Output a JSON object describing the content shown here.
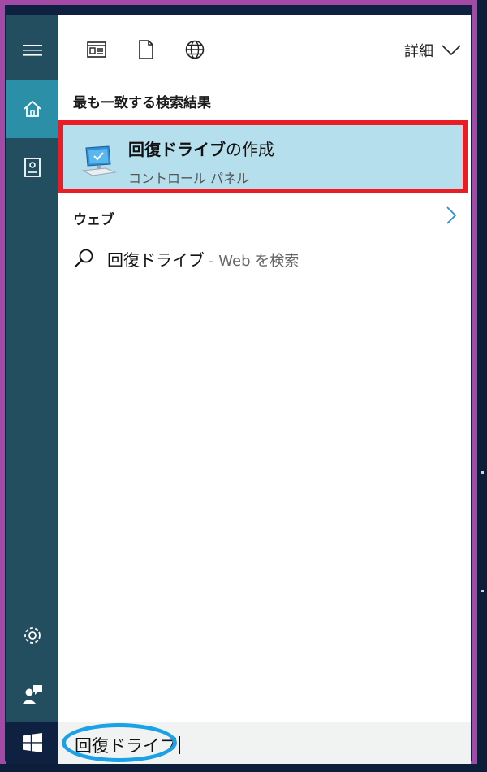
{
  "toolbar": {
    "icons": [
      "news-app-icon",
      "document-icon",
      "globe-icon"
    ],
    "details_label": "詳細"
  },
  "sidebar": {
    "items": [
      "hamburger-menu-icon",
      "home-icon",
      "notebook-icon"
    ],
    "bottom": [
      "settings-icon",
      "feedback-icon"
    ]
  },
  "results": {
    "best_match_header": "最も一致する検索結果",
    "best_match": {
      "title_bold": "回復ドライブ",
      "title_rest": "の作成",
      "subtitle": "コントロール パネル"
    },
    "web_header": "ウェブ",
    "web_item": {
      "query": "回復ドライブ",
      "suffix": "- Web を検索"
    }
  },
  "search": {
    "value": "回復ドライブ"
  },
  "colors": {
    "sidebar": "#224e60",
    "sidebar_active": "#2b8fa8",
    "highlight": "#b5dfec",
    "red_outline": "#ec1c24",
    "blue_ring": "#1aa1e6",
    "frame": "#a24aa6"
  }
}
